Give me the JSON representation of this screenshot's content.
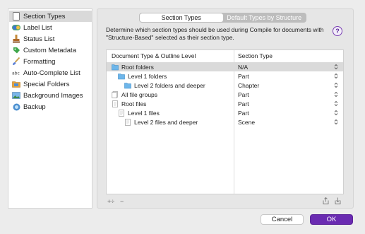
{
  "colors": {
    "accent": "#6a2bb1",
    "selected_row": "#dadada",
    "folder_blue": "#6eb6ea"
  },
  "sidebar": {
    "items": [
      {
        "label": "Section Types",
        "icon": "document-icon",
        "selected": true
      },
      {
        "label": "Label List",
        "icon": "label-toggle-icon"
      },
      {
        "label": "Status List",
        "icon": "stamp-icon"
      },
      {
        "label": "Custom Metadata",
        "icon": "metadata-tag-icon"
      },
      {
        "label": "Formatting",
        "icon": "paintbrush-icon"
      },
      {
        "label": "Auto-Complete List",
        "icon": "abc-icon"
      },
      {
        "label": "Special Folders",
        "icon": "special-folder-icon"
      },
      {
        "label": "Background Images",
        "icon": "image-icon"
      },
      {
        "label": "Backup",
        "icon": "backup-icon"
      }
    ]
  },
  "tabs": {
    "left": "Section Types",
    "right": "Default Types by Structure"
  },
  "description": "Determine which section types should be used during Compile for documents with \"Structure-Based\" selected as their section type.",
  "help_label": "?",
  "table": {
    "headers": {
      "name": "Document Type & Outline Level",
      "type": "Section Type"
    },
    "rows": [
      {
        "name": "Root folders",
        "type": "N/A",
        "kind": "folder",
        "level": 0,
        "selected": true
      },
      {
        "name": "Level 1 folders",
        "type": "Part",
        "kind": "folder",
        "level": 1
      },
      {
        "name": "Level 2 folders and deeper",
        "type": "Chapter",
        "kind": "folder",
        "level": 2
      },
      {
        "name": "All file groups",
        "type": "Part",
        "kind": "filegroup",
        "level": 0
      },
      {
        "name": "Root files",
        "type": "Part",
        "kind": "file",
        "level": 0
      },
      {
        "name": "Level 1 files",
        "type": "Part",
        "kind": "file",
        "level": 1
      },
      {
        "name": "Level 2 files and deeper",
        "type": "Scene",
        "kind": "file",
        "level": 2
      }
    ]
  },
  "toolbar": {
    "add_label": "+÷",
    "remove_label": "−"
  },
  "buttons": {
    "cancel": "Cancel",
    "ok": "OK"
  }
}
